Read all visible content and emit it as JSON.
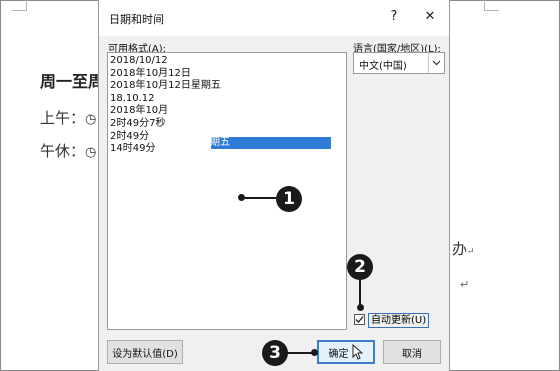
{
  "document": {
    "heading": "周一至周",
    "line_morning": "上午：",
    "line_noon": "午休：",
    "right_fragment": "办",
    "paragraph_mark": "↵"
  },
  "dialog": {
    "title": "日期和时间",
    "help_label": "?",
    "close_label": "✕",
    "formats_label": "可用格式(A):",
    "formats": [
      "2018/10/12",
      "2018年10月12日",
      "2018年10月12日星期五",
      "18.10.12",
      "2018年10月",
      "2时49分7秒",
      "2时49分",
      "14时49分"
    ],
    "selected_fragment": "期五",
    "language_label": "语言(国家/地区)(L):",
    "language_value": "中文(中国)",
    "auto_update_label": "自动更新(U)",
    "auto_update_checked": true,
    "set_default_label": "设为默认值(D)",
    "ok_label": "确定",
    "cancel_label": "取消"
  },
  "callouts": [
    "1",
    "2",
    "3"
  ],
  "colors": {
    "selection": "#2f7bd6",
    "callout": "#1a1a1a",
    "default_button_border": "#3c7fc8"
  }
}
